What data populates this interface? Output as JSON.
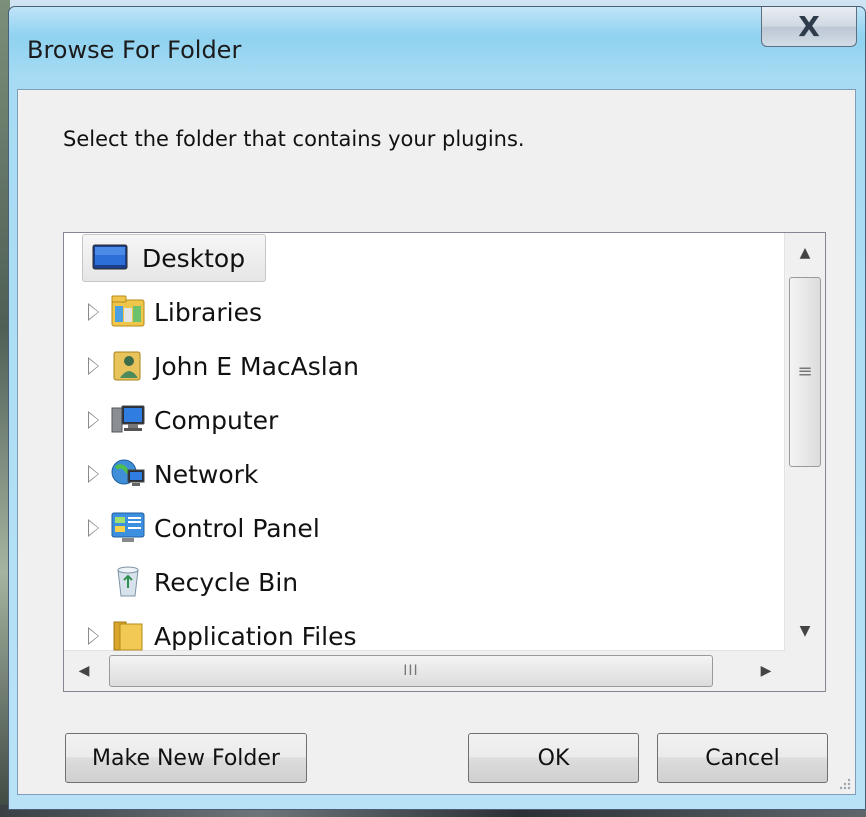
{
  "window": {
    "title": "Browse For Folder",
    "close_glyph": "X"
  },
  "prompt": "Select the folder that contains your plugins.",
  "tree": {
    "items": [
      {
        "label": "Desktop",
        "icon": "desktop-icon",
        "expander": false,
        "selected": true
      },
      {
        "label": "Libraries",
        "icon": "libraries-icon",
        "expander": true,
        "selected": false
      },
      {
        "label": "John E MacAslan",
        "icon": "user-folder-icon",
        "expander": true,
        "selected": false
      },
      {
        "label": "Computer",
        "icon": "computer-icon",
        "expander": true,
        "selected": false
      },
      {
        "label": "Network",
        "icon": "network-icon",
        "expander": true,
        "selected": false
      },
      {
        "label": "Control Panel",
        "icon": "control-panel-icon",
        "expander": true,
        "selected": false
      },
      {
        "label": "Recycle Bin",
        "icon": "recycle-bin-icon",
        "expander": false,
        "selected": false
      },
      {
        "label": "Application Files",
        "icon": "folder-icon",
        "expander": true,
        "selected": false
      }
    ]
  },
  "scrollbar": {
    "vertical_grip": "≡",
    "horizontal_grip": "III"
  },
  "buttons": {
    "make_new_folder": "Make New Folder",
    "ok": "OK",
    "cancel": "Cancel"
  },
  "colors": {
    "title_bar": "#8fd2f0",
    "dialog_bg": "#f0f0f0",
    "tree_bg": "#ffffff"
  }
}
